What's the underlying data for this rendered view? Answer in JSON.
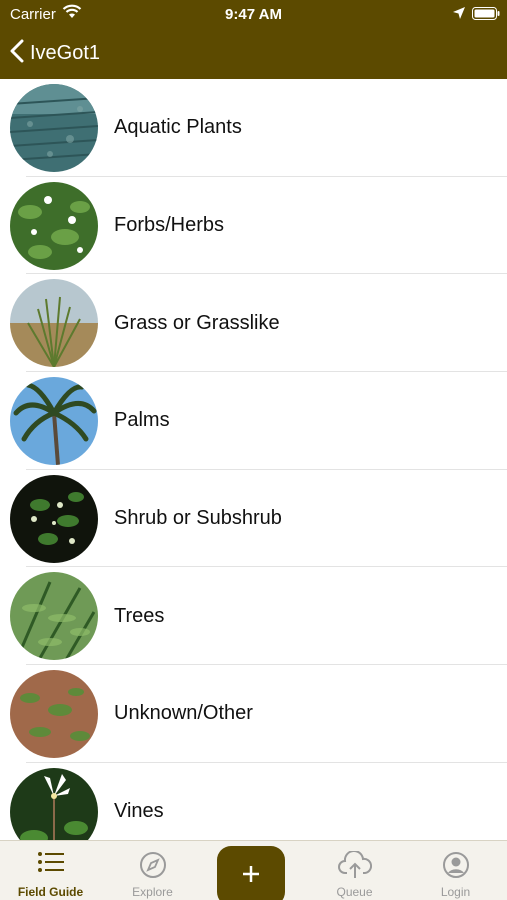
{
  "status_bar": {
    "carrier": "Carrier",
    "time": "9:47 AM"
  },
  "nav": {
    "back_label": "IveGot1"
  },
  "categories": [
    {
      "label": "Aquatic Plants"
    },
    {
      "label": "Forbs/Herbs"
    },
    {
      "label": "Grass or Grasslike"
    },
    {
      "label": "Palms"
    },
    {
      "label": "Shrub or Subshrub"
    },
    {
      "label": "Trees"
    },
    {
      "label": "Unknown/Other"
    },
    {
      "label": "Vines"
    }
  ],
  "tabs": [
    {
      "label": "Field Guide",
      "icon": "list-icon",
      "active": true
    },
    {
      "label": "Explore",
      "icon": "compass-icon",
      "active": false
    },
    {
      "label": "Queue",
      "icon": "cloud-upload-icon",
      "active": false
    },
    {
      "label": "Login",
      "icon": "user-circle-icon",
      "active": false
    }
  ],
  "add_button": {
    "icon": "plus-icon"
  },
  "colors": {
    "brand": "#5c4a00",
    "tab_inactive": "#9a9a9a",
    "separator": "#e3e3e3"
  }
}
